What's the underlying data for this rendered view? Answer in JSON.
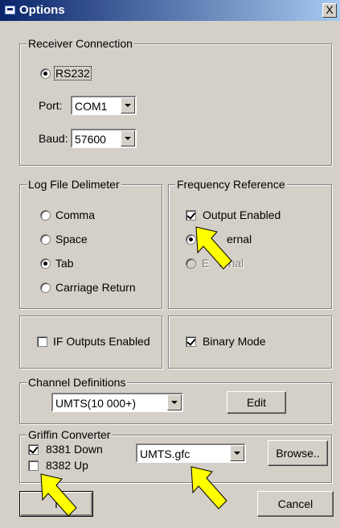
{
  "window": {
    "title": "Options",
    "close_glyph": "X"
  },
  "receiver": {
    "legend": "Receiver Connection",
    "rs232_label": "RS232",
    "port_label": "Port:",
    "port_value": "COM1",
    "baud_label": "Baud:",
    "baud_value": "57600"
  },
  "log_delimiter": {
    "legend": "Log File Delimeter",
    "options": [
      {
        "label": "Comma",
        "selected": false
      },
      {
        "label": "Space",
        "selected": false
      },
      {
        "label": "Tab",
        "selected": true
      },
      {
        "label": "Carriage Return",
        "selected": false
      }
    ]
  },
  "frequency": {
    "legend": "Frequency Reference",
    "output_enabled_label": "Output Enabled",
    "output_enabled": true,
    "internal_label": "Internal",
    "internal_label_visible": "ernal",
    "external_label": "External",
    "external_visible": "E   ernal"
  },
  "if_outputs": {
    "label": "IF Outputs Enabled",
    "checked": false
  },
  "binary_mode": {
    "label": "Binary Mode",
    "checked": true
  },
  "channel": {
    "legend": "Channel Definitions",
    "value": "UMTS(10 000+)",
    "edit_label": "Edit"
  },
  "griffin": {
    "legend": "Griffin Converter",
    "down_label": "8381 Down",
    "down_checked": true,
    "up_label": "8382 Up",
    "up_checked": false,
    "file_value": "UMTS.gfc",
    "browse_label": "Browse.."
  },
  "footer": {
    "ok_label": "OK",
    "ok_visible": "I",
    "cancel_label": "Cancel"
  },
  "colors": {
    "dialog_bg": "#d4d0c8",
    "title_start": "#0a246a",
    "title_end": "#a6caf0",
    "annotation_arrow": "#ffff00"
  },
  "icons": [
    "window-icon",
    "close-icon",
    "dropdown-arrow-icon",
    "annotation-arrow-icon"
  ]
}
